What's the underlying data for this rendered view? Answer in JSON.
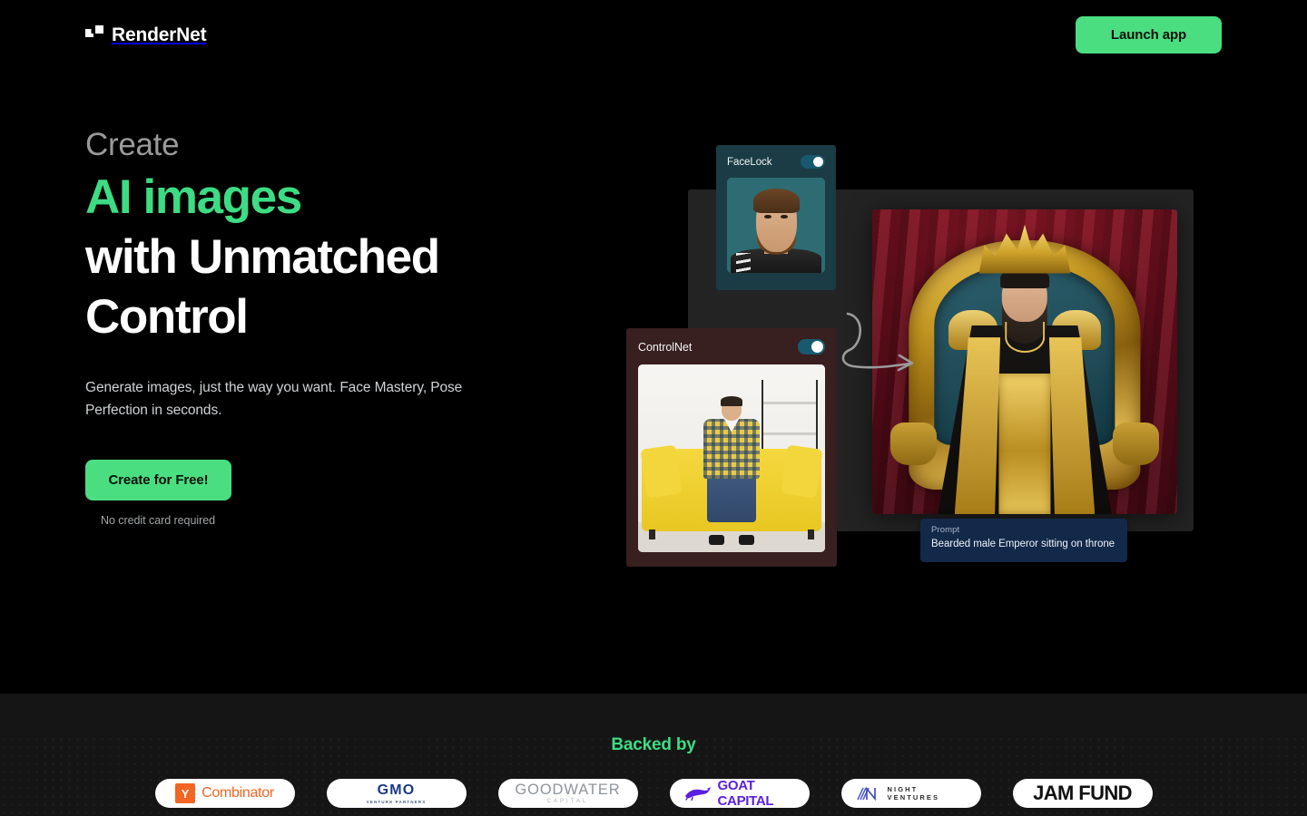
{
  "header": {
    "brand_name": "RenderNet",
    "brand_icon": "overlapping-squares-logo",
    "launch_label": "Launch app"
  },
  "hero": {
    "eyebrow": "Create",
    "headline_accent": "AI images",
    "headline_line2": "with Unmatched",
    "headline_line3": "Control",
    "subcopy": "Generate images, just the way you want. Face Mastery, Pose Perfection in seconds.",
    "cta_label": "Create for Free!",
    "cta_note": "No credit card required",
    "accent_color": "#3ddc84",
    "button_color": "#4ade80"
  },
  "showcase": {
    "facelock": {
      "title": "FaceLock",
      "toggle_state": "on",
      "card_color": "#1b3c45",
      "thumb_alt": "portrait of bearded man with teal background"
    },
    "controlnet": {
      "title": "ControlNet",
      "toggle_state": "on",
      "card_color": "#381f20",
      "thumb_alt": "man in plaid shirt sitting on yellow sofa"
    },
    "arrow_icon": "curved-loop-arrow-right",
    "output": {
      "alt": "bearded emperor in gold robes sitting on golden throne with red curtain"
    },
    "prompt": {
      "label": "Prompt",
      "value": "Bearded male Emperor sitting on throne",
      "box_color": "#12294a"
    }
  },
  "backed": {
    "title": "Backed by",
    "title_color": "#3ddc84",
    "logos": [
      {
        "id": "y-combinator",
        "mark": "Y",
        "name": "Combinator",
        "color": "#f26522"
      },
      {
        "id": "gmo",
        "name": "GMO",
        "sub": "VENTURE PARTNERS",
        "color": "#1b3a86"
      },
      {
        "id": "goodwater",
        "name": "GOODWATER",
        "sub": "CAPITAL",
        "color": "#8e949c"
      },
      {
        "id": "goat-capital",
        "name": "GOAT CAPITAL",
        "color": "#5b1fe0"
      },
      {
        "id": "night-ventures",
        "name": "NIGHT VENTURES",
        "color": "#2b2b2b"
      },
      {
        "id": "jam-fund",
        "name": "JAM FUND",
        "color": "#111111"
      }
    ]
  }
}
